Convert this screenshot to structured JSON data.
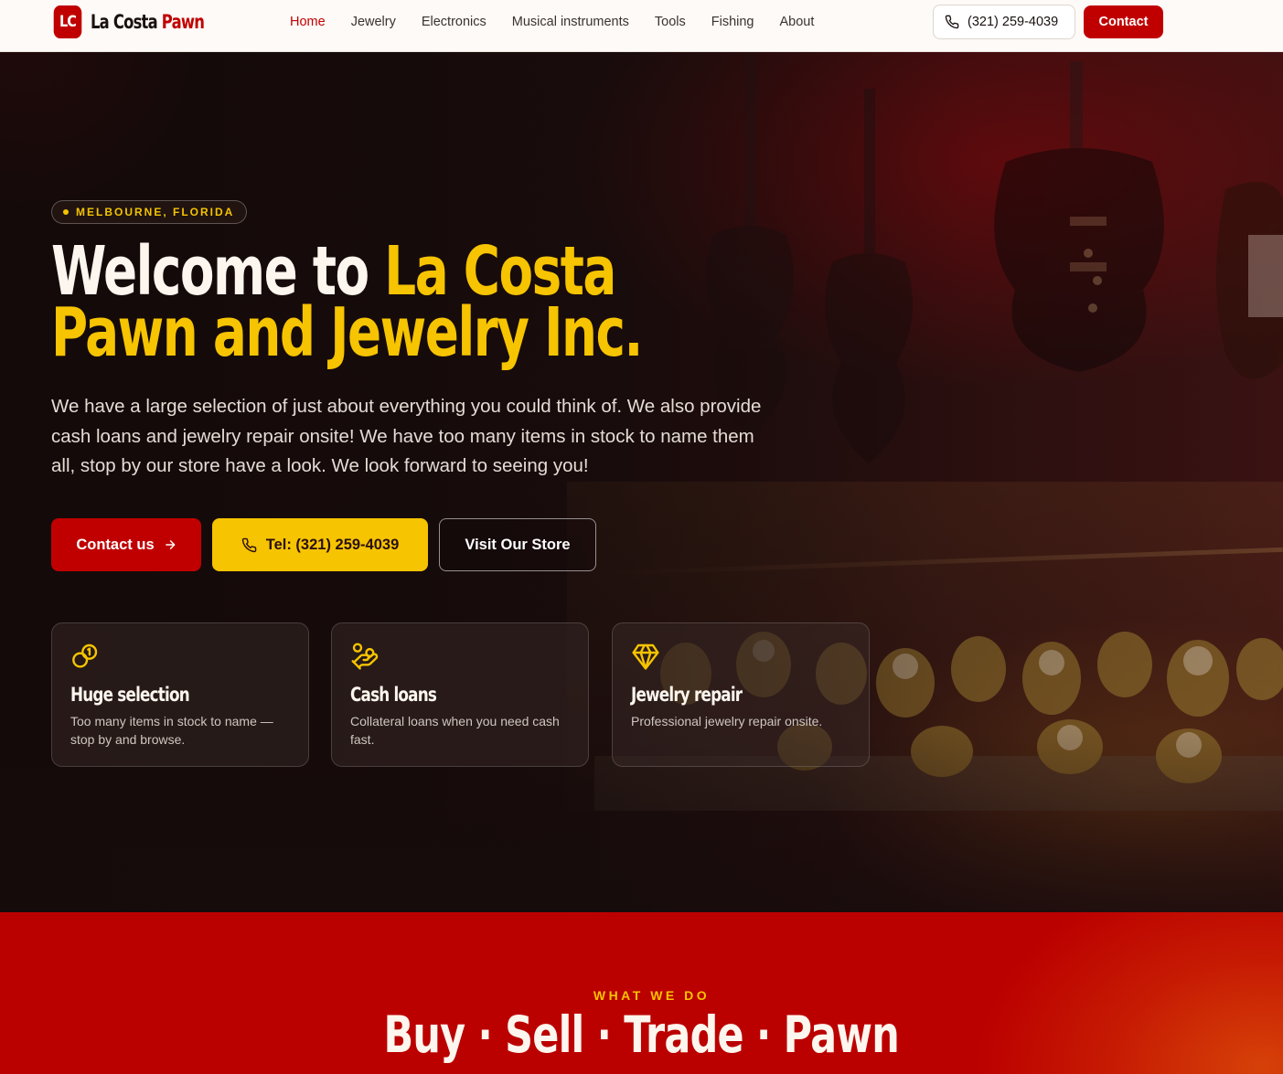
{
  "nav": {
    "logo_badge": "LC",
    "logo_name": "La Costa",
    "logo_accent": "Pawn",
    "items": [
      {
        "label": "Home",
        "active": true
      },
      {
        "label": "Jewelry",
        "active": false
      },
      {
        "label": "Electronics",
        "active": false
      },
      {
        "label": "Musical instruments",
        "active": false
      },
      {
        "label": "Tools",
        "active": false
      },
      {
        "label": "Fishing",
        "active": false
      },
      {
        "label": "About",
        "active": false
      }
    ],
    "phone": "(321) 259-4039",
    "phone_icon": "phone-icon",
    "contact_label": "Contact"
  },
  "hero": {
    "location": "MELBOURNE, FLORIDA",
    "title_white": "Welcome to ",
    "title_gold_1": "La Costa",
    "title_gold_2": "Pawn and Jewelry Inc.",
    "lead": "We have a large selection of just about everything you could think of. We also provide cash loans and jewelry repair onsite! We have too many items in stock to name them all, stop by our store have a look. We look forward to seeing you!",
    "btn_contact": "Contact us",
    "btn_contact_icon": "arrow-right-icon",
    "btn_tel": "Tel: (321) 259-4039",
    "btn_tel_icon": "phone-icon",
    "btn_visit": "Visit Our Store",
    "cards": [
      {
        "icon": "coins-icon",
        "title": "Huge selection",
        "text": "Too many items in stock to name — stop by and browse."
      },
      {
        "icon": "hand-coins-icon",
        "title": "Cash loans",
        "text": "Collateral loans when you need cash fast."
      },
      {
        "icon": "gem-icon",
        "title": "Jewelry repair",
        "text": "Professional jewelry repair onsite."
      }
    ]
  },
  "section": {
    "eyebrow": "WHAT WE DO",
    "title": "Buy · Sell · Trade · Pawn"
  },
  "colors": {
    "brand_red": "#c00000",
    "gold": "#f6c400",
    "nav_bg": "#fdfaf7",
    "hero_dark": "#1a0c0c"
  }
}
